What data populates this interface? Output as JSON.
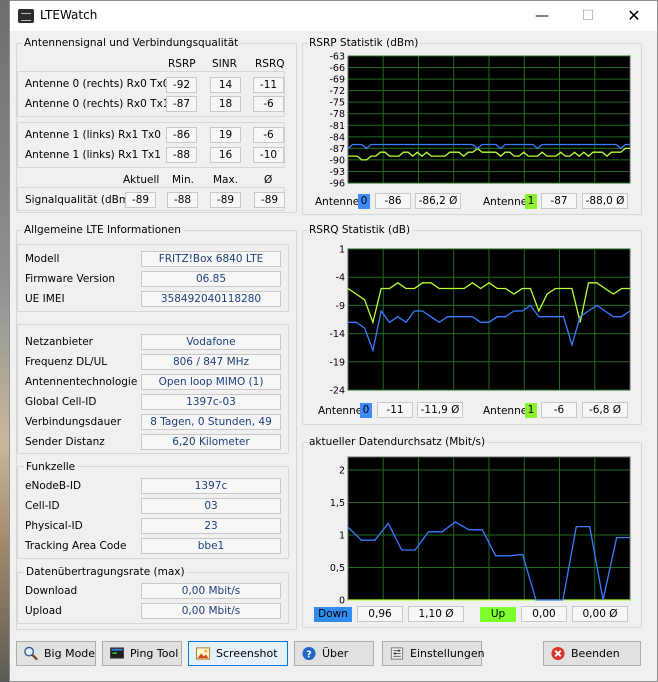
{
  "window": {
    "title": "LTEWatch",
    "min_glyph": "—",
    "max_glyph": "☐",
    "close_glyph": "✕"
  },
  "signal": {
    "group_label": "Antennensignal und Verbindungsqualität",
    "headers": [
      "RSRP",
      "SINR",
      "RSRQ"
    ],
    "rows": [
      {
        "label": "Antenne 0 (rechts) Rx0 Tx0",
        "values": [
          "-92",
          "14",
          "-11"
        ]
      },
      {
        "label": "Antenne 0 (rechts) Rx0 Tx1",
        "values": [
          "-87",
          "18",
          "-6"
        ]
      },
      {
        "label": "Antenne 1 (links) Rx1 Tx0",
        "values": [
          "-86",
          "19",
          "-6"
        ]
      },
      {
        "label": "Antenne 1 (links) Rx1 Tx1",
        "values": [
          "-88",
          "16",
          "-10"
        ]
      }
    ],
    "quality_headers": [
      "Aktuell",
      "Min.",
      "Max.",
      "Ø"
    ],
    "quality_label": "Signalqualität (dBm)",
    "quality_values": [
      "-89",
      "-88",
      "-89",
      "-89"
    ]
  },
  "lte": {
    "group_label": "Allgemeine LTE Informationen",
    "device": [
      {
        "label": "Modell",
        "value": "FRITZ!Box 6840 LTE"
      },
      {
        "label": "Firmware Version",
        "value": "06.85"
      },
      {
        "label": "UE IMEI",
        "value": "358492040118280"
      }
    ],
    "network": [
      {
        "label": "Netzanbieter",
        "value": "Vodafone"
      },
      {
        "label": "Frequenz DL/UL",
        "value": "806 / 847 MHz"
      },
      {
        "label": "Antennentechnologie",
        "value": "Open loop MIMO (1)"
      },
      {
        "label": "Global Cell-ID",
        "value": "1397c-03"
      },
      {
        "label": "Verbindungsdauer",
        "value": "8 Tagen, 0 Stunden, 49"
      },
      {
        "label": "Sender Distanz",
        "value": "6,20 Kilometer"
      }
    ]
  },
  "funkzelle": {
    "group_label": "Funkzelle",
    "rows": [
      {
        "label": "eNodeB-ID",
        "value": "1397c"
      },
      {
        "label": "Cell-ID",
        "value": "03"
      },
      {
        "label": "Physical-ID",
        "value": "23"
      },
      {
        "label": "Tracking Area Code",
        "value": "bbe1"
      }
    ]
  },
  "rate": {
    "group_label": "Datenübertragungsrate (max)",
    "rows": [
      {
        "label": "Download",
        "value": "0,00 Mbit/s"
      },
      {
        "label": "Upload",
        "value": "0,00 Mbit/s"
      }
    ]
  },
  "rsrp_panel": {
    "title": "RSRP Statistik (dBm)",
    "legend": [
      {
        "label": "Antenne",
        "badge": "0",
        "current": "-86",
        "avg": "-86,2 Ø"
      },
      {
        "label": "Antenne",
        "badge": "1",
        "current": "-87",
        "avg": "-88,0 Ø"
      }
    ]
  },
  "rsrq_panel": {
    "title": "RSRQ Statistik (dB)",
    "legend": [
      {
        "label": "Antenne",
        "badge": "0",
        "current": "-11",
        "avg": "-11,9 Ø"
      },
      {
        "label": "Antenne",
        "badge": "1",
        "current": "-6",
        "avg": "-6,8 Ø"
      }
    ]
  },
  "throughput_panel": {
    "title": "aktueller Datendurchsatz (Mbit/s)",
    "legend": [
      {
        "label": "Down",
        "current": "0,96",
        "avg": "1,10 Ø"
      },
      {
        "label": "Up",
        "current": "0,00",
        "avg": "0,00 Ø"
      }
    ]
  },
  "colors": {
    "blue_series": "#3a7bff",
    "green_series": "#b8ff3a",
    "grid": "#1f6b1f",
    "down_badge": "#2f8cf0",
    "up_badge": "#7cff2c",
    "badge0": "#3d8bff",
    "badge1": "#8cf02a"
  },
  "chart_data": [
    {
      "type": "line",
      "title": "RSRP Statistik (dBm)",
      "ylim": [
        -96,
        -63
      ],
      "yticks": [
        "-63",
        "-66",
        "-69",
        "-72",
        "-75",
        "-78",
        "-81",
        "-84",
        "-87",
        "-90",
        "-93",
        "-96"
      ],
      "series": [
        {
          "name": "Antenne 0",
          "color": "blue",
          "values": [
            -87,
            -86,
            -86,
            -86,
            -87,
            -86,
            -86,
            -86,
            -86,
            -86,
            -86,
            -86,
            -86,
            -86,
            -86,
            -86,
            -86,
            -86,
            -86,
            -86,
            -86,
            -86,
            -86,
            -86,
            -86,
            -86,
            -86,
            -86,
            -87,
            -86,
            -86,
            -86,
            -86,
            -87,
            -86,
            -86,
            -86,
            -86,
            -86,
            -86,
            -86,
            -87,
            -86,
            -86,
            -86,
            -86,
            -86,
            -86,
            -86,
            -86,
            -86,
            -86,
            -86,
            -86,
            -86,
            -86,
            -86,
            -86,
            -86,
            -87,
            -86,
            -86
          ]
        },
        {
          "name": "Antenne 1",
          "color": "green",
          "values": [
            -89,
            -89,
            -89,
            -90,
            -90,
            -89,
            -89,
            -88,
            -88,
            -89,
            -89,
            -89,
            -88,
            -88,
            -89,
            -88,
            -89,
            -88,
            -89,
            -89,
            -89,
            -89,
            -88,
            -88,
            -88,
            -89,
            -88,
            -88,
            -87,
            -88,
            -88,
            -88,
            -88,
            -89,
            -88,
            -88,
            -89,
            -89,
            -88,
            -89,
            -89,
            -89,
            -88,
            -89,
            -89,
            -89,
            -88,
            -89,
            -89,
            -88,
            -89,
            -88,
            -89,
            -88,
            -88,
            -88,
            -89,
            -88,
            -88,
            -88,
            -87,
            -87
          ]
        }
      ]
    },
    {
      "type": "line",
      "title": "RSRQ Statistik (dB)",
      "ylim": [
        -24,
        1
      ],
      "yticks": [
        "1",
        "-4",
        "-9",
        "-14",
        "-19",
        "-24"
      ],
      "series": [
        {
          "name": "Antenne 0",
          "color": "blue",
          "values": [
            -12,
            -12,
            -13,
            -17,
            -10,
            -12,
            -11,
            -12,
            -10,
            -10,
            -11,
            -12,
            -11,
            -11,
            -11,
            -11,
            -12,
            -12,
            -11,
            -11,
            -10,
            -10,
            -9,
            -11,
            -11,
            -11,
            -11,
            -16,
            -11,
            -10,
            -9,
            -10,
            -11,
            -11,
            -10
          ]
        },
        {
          "name": "Antenne 1",
          "color": "green",
          "values": [
            -6,
            -7,
            -8,
            -12,
            -6,
            -6,
            -5,
            -6,
            -6,
            -5,
            -5,
            -6,
            -6,
            -6,
            -6,
            -5,
            -6,
            -5,
            -6,
            -6,
            -7,
            -6,
            -6,
            -10,
            -7,
            -6,
            -6,
            -6,
            -12,
            -5,
            -5,
            -6,
            -7,
            -6,
            -6
          ]
        }
      ]
    },
    {
      "type": "line",
      "title": "aktueller Datendurchsatz (Mbit/s)",
      "ylim": [
        0,
        2.2
      ],
      "yticks": [
        "2",
        "1,5",
        "1",
        "0,5",
        "0"
      ],
      "series": [
        {
          "name": "Down",
          "color": "blue",
          "values": [
            1.12,
            0.92,
            0.92,
            1.18,
            0.77,
            0.77,
            1.05,
            1.05,
            1.2,
            1.08,
            1.08,
            0.68,
            0.68,
            0.7,
            0.0,
            0.0,
            0.0,
            1.13,
            1.13,
            0.0,
            0.96,
            0.96
          ]
        },
        {
          "name": "Up",
          "color": "green",
          "values": [
            0,
            0,
            0,
            0,
            0,
            0,
            0,
            0,
            0,
            0,
            0,
            0,
            0,
            0,
            0,
            0,
            0,
            0,
            0,
            0,
            0,
            0
          ]
        }
      ]
    }
  ],
  "buttons": {
    "bigmode": "Big Mode",
    "ping": "Ping Tool",
    "screenshot": "Screenshot",
    "about": "Über",
    "settings": "Einstellungen",
    "exit": "Beenden"
  }
}
